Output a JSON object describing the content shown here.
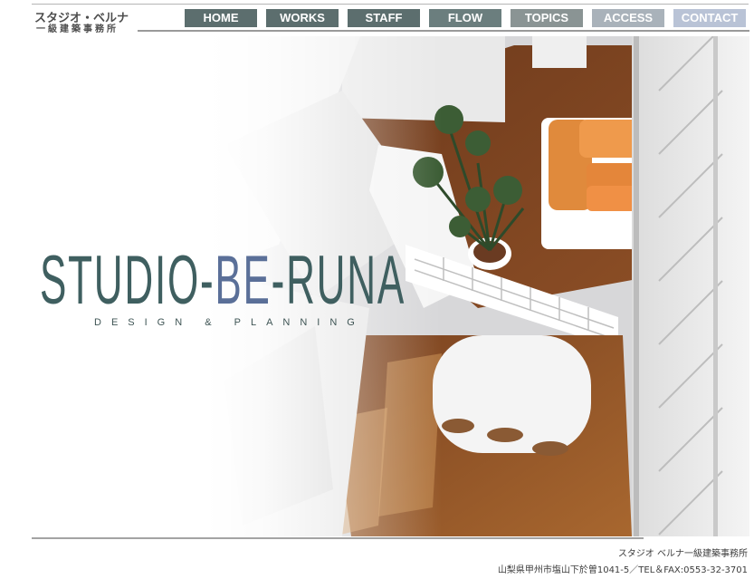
{
  "logo": {
    "line1": "スタジオ・ベルナ",
    "line2": "一級建築事務所"
  },
  "nav": {
    "items": [
      {
        "label": "HOME",
        "color": "#5c6e6e"
      },
      {
        "label": "WORKS",
        "color": "#5c6e6e"
      },
      {
        "label": "STAFF",
        "color": "#5c6e6e"
      },
      {
        "label": "FLOW",
        "color": "#6b7e7e"
      },
      {
        "label": "TOPICS",
        "color": "#8a9494"
      },
      {
        "label": "ACCESS",
        "color": "#a9b2ba"
      },
      {
        "label": "CONTACT",
        "color": "#b9c3d6"
      }
    ]
  },
  "hero": {
    "brand_part1": "STUDIO-",
    "brand_part2": "BE",
    "brand_part3": "-RUNA",
    "tagline": "DESIGN & PLANNING",
    "brand_color": "#3f5f60",
    "accent_color": "#5a6f98"
  },
  "footer": {
    "company": "スタジオ ベルナ一級建築事務所",
    "address": "山梨県甲州市塩山下於曽1041-5／TEL＆FAX:0553-32-3701"
  }
}
